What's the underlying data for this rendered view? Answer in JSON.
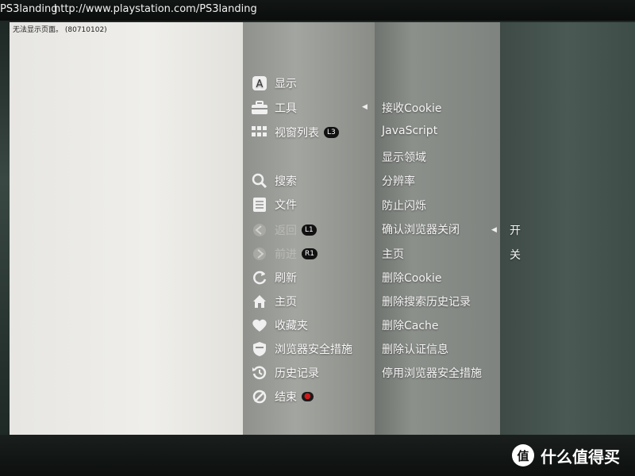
{
  "topbar": {
    "title": "PS3landing",
    "url": "http://www.playstation.com/PS3landing"
  },
  "page": {
    "error_text": "无法显示页面。 (80710102)"
  },
  "menu": {
    "items": [
      {
        "label": "显示",
        "icon": "a-button-icon"
      },
      {
        "label": "工具",
        "icon": "toolbox-icon",
        "selected": true
      },
      {
        "label": "视窗列表",
        "icon": "window-list-icon",
        "badge": "L3"
      },
      {
        "label": "搜索",
        "icon": "search-icon"
      },
      {
        "label": "文件",
        "icon": "file-icon"
      },
      {
        "label": "返回",
        "icon": "back-icon",
        "badge": "L1",
        "disabled": true
      },
      {
        "label": "前进",
        "icon": "forward-icon",
        "badge": "R1",
        "disabled": true
      },
      {
        "label": "刷新",
        "icon": "refresh-icon"
      },
      {
        "label": "主页",
        "icon": "home-icon"
      },
      {
        "label": "收藏夹",
        "icon": "heart-icon"
      },
      {
        "label": "浏览器安全措施",
        "icon": "shield-icon"
      },
      {
        "label": "历史记录",
        "icon": "history-icon"
      },
      {
        "label": "结束",
        "icon": "exit-icon",
        "badge": "●"
      }
    ]
  },
  "tools_submenu": {
    "items": [
      "接收Cookie",
      "JavaScript",
      "显示领域",
      "分辨率",
      "防止闪烁",
      "确认浏览器关闭",
      "主页",
      "删除Cookie",
      "删除搜索历史记录",
      "删除Cache",
      "删除认证信息",
      "停用浏览器安全措施"
    ]
  },
  "options": {
    "items": [
      "开",
      "关"
    ]
  },
  "watermark": {
    "icon_glyph": "值",
    "text": "什么值得买"
  },
  "colors": {
    "text": "#fafafa",
    "disabled_text": "#b9bab6",
    "badge_bg": "#111111",
    "exit_badge": "#cc1b1b"
  }
}
